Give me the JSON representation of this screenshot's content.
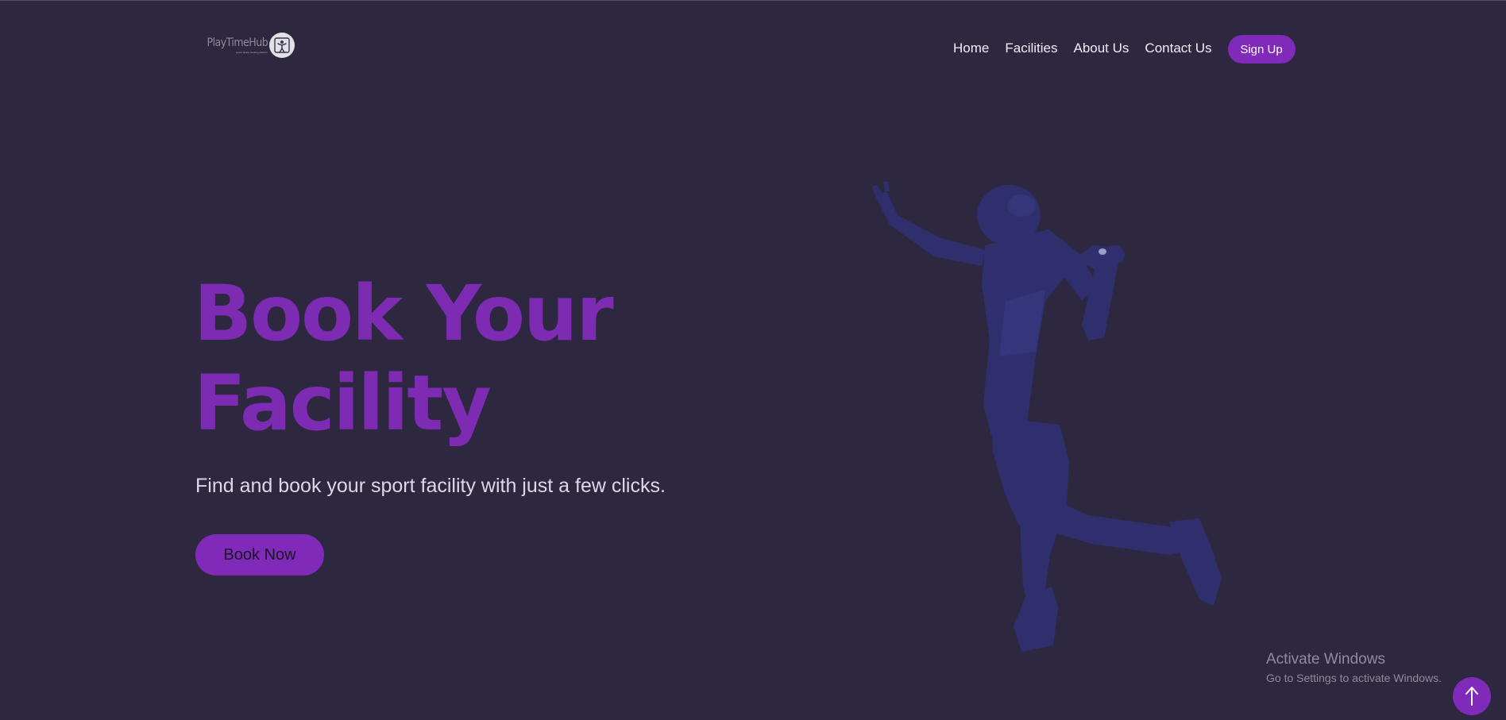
{
  "brand": {
    "name": "PlayTimeHub",
    "tagline": "sports facility booking platform",
    "logo_icon": "athlete-icon"
  },
  "nav": {
    "links": [
      "Home",
      "Facilities",
      "About Us",
      "Contact Us"
    ],
    "signup_label": "Sign Up"
  },
  "hero": {
    "title_line1": "Book Your",
    "title_line2": "Facility",
    "subtitle": "Find and book your sport facility with just a few clicks.",
    "cta_label": "Book Now",
    "image": "badminton-player-illustration"
  },
  "watermark": {
    "title": "Activate Windows",
    "subtitle": "Go to Settings to activate Windows."
  },
  "scroll_top_icon": "arrow-up-icon",
  "colors": {
    "background": "#2d2840",
    "accent": "#7f2ab8",
    "title": "#7e2bb4",
    "player": "#2f2f6d"
  }
}
